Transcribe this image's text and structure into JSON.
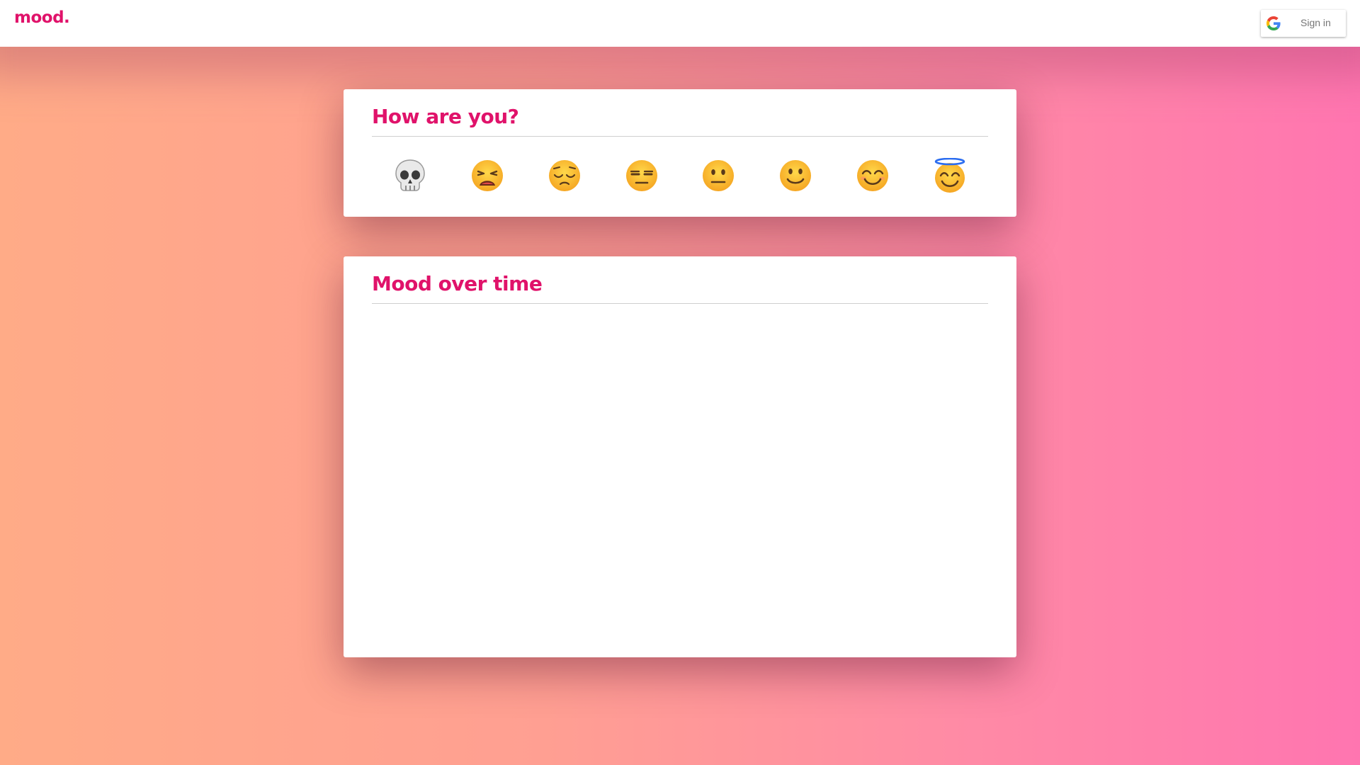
{
  "app": {
    "logo": "mood."
  },
  "signin": {
    "label": "Sign in",
    "icon": "google-icon"
  },
  "mood_card": {
    "title": "How are you?",
    "options": [
      {
        "icon": "skull-icon"
      },
      {
        "icon": "weary-face-icon"
      },
      {
        "icon": "pensive-face-icon"
      },
      {
        "icon": "unamused-face-icon"
      },
      {
        "icon": "neutral-face-icon"
      },
      {
        "icon": "slightly-smiling-face-icon"
      },
      {
        "icon": "smiling-face-icon"
      },
      {
        "icon": "halo-face-icon"
      }
    ]
  },
  "chart_card": {
    "title": "Mood over time"
  },
  "colors": {
    "accent": "#e0126a",
    "gradient_left": "#ffab87",
    "gradient_right": "#ff75b0"
  }
}
